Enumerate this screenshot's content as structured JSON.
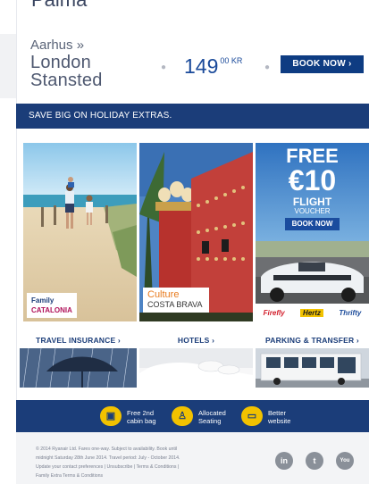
{
  "top_cut_text": "Palma",
  "route": {
    "from": "Aarhus »",
    "to_line1": "London",
    "to_line2": "Stansted",
    "price_main": "149",
    "price_sup": "00 KR",
    "book_label": "BOOK NOW ›"
  },
  "banner": {
    "label": "SAVE BIG ON HOLIDAY EXTRAS."
  },
  "tiles": [
    {
      "category": "Family",
      "place": "CATALONIA"
    },
    {
      "category": "Culture",
      "place": "COSTA BRAVA"
    },
    {
      "free": "FREE",
      "amount": "€10",
      "flight": "FLIGHT",
      "voucher": "VOUCHER",
      "button": "BOOK NOW",
      "brands": [
        "Firefly",
        "Hertz",
        "Thrifty"
      ]
    }
  ],
  "services": [
    {
      "label": "TRAVEL INSURANCE ›"
    },
    {
      "label": "HOTELS ›"
    },
    {
      "label": "PARKING & TRANSFER ›"
    }
  ],
  "perks": [
    {
      "line1": "Free 2nd",
      "line2": "cabin bag",
      "icon": "bag-icon"
    },
    {
      "line1": "Allocated",
      "line2": "Seating",
      "icon": "seat-icon"
    },
    {
      "line1": "Better",
      "line2": "website",
      "icon": "monitor-icon"
    }
  ],
  "legal": {
    "line1": "© 2014 Ryanair Ltd. Fares one-way. Subject to availability. Book until",
    "line2": "midnight Saturday 28th June 2014. Travel period: July - October 2014.",
    "line3": "Update your contact preferences | Unsubscribe | Terms & Conditions |",
    "line4": "Family Extra Terms & Conditions"
  },
  "social": [
    "in",
    "t",
    "You"
  ],
  "colors": {
    "navy": "#1b3d79",
    "yellow": "#f2c200",
    "price_blue": "#1a4a9a"
  }
}
